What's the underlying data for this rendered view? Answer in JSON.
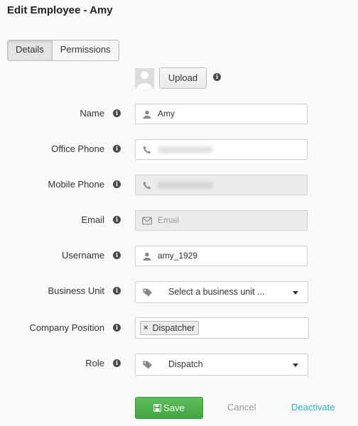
{
  "title": "Edit Employee - Amy",
  "tabs": [
    {
      "label": "Details",
      "active": true
    },
    {
      "label": "Permissions",
      "active": false
    }
  ],
  "upload": {
    "label": "Upload"
  },
  "fields": {
    "name": {
      "label": "Name",
      "value": "Amy",
      "icon": "user-icon"
    },
    "office_phone": {
      "label": "Office Phone",
      "value": "",
      "icon": "phone-icon"
    },
    "mobile_phone": {
      "label": "Mobile Phone",
      "value": "",
      "icon": "phone-icon",
      "disabled": true
    },
    "email": {
      "label": "Email",
      "placeholder": "Email",
      "icon": "envelope-icon",
      "disabled": true
    },
    "username": {
      "label": "Username",
      "value": "amy_1929",
      "icon": "user-icon"
    },
    "business_unit": {
      "label": "Business Unit",
      "value": "Select a business unit ...",
      "icon": "tag-icon"
    },
    "company_position": {
      "label": "Company Position",
      "tags": [
        "Dispatcher"
      ]
    },
    "role": {
      "label": "Role",
      "value": "Dispatch",
      "icon": "tag-icon"
    }
  },
  "actions": {
    "save": "Save",
    "cancel": "Cancel",
    "deactivate": "Deactivate"
  },
  "colors": {
    "save_button": "#4cae4a",
    "deactivate_link": "#2bb3c9",
    "cancel_link": "#999999",
    "info_icon": "#4a4a4a"
  }
}
